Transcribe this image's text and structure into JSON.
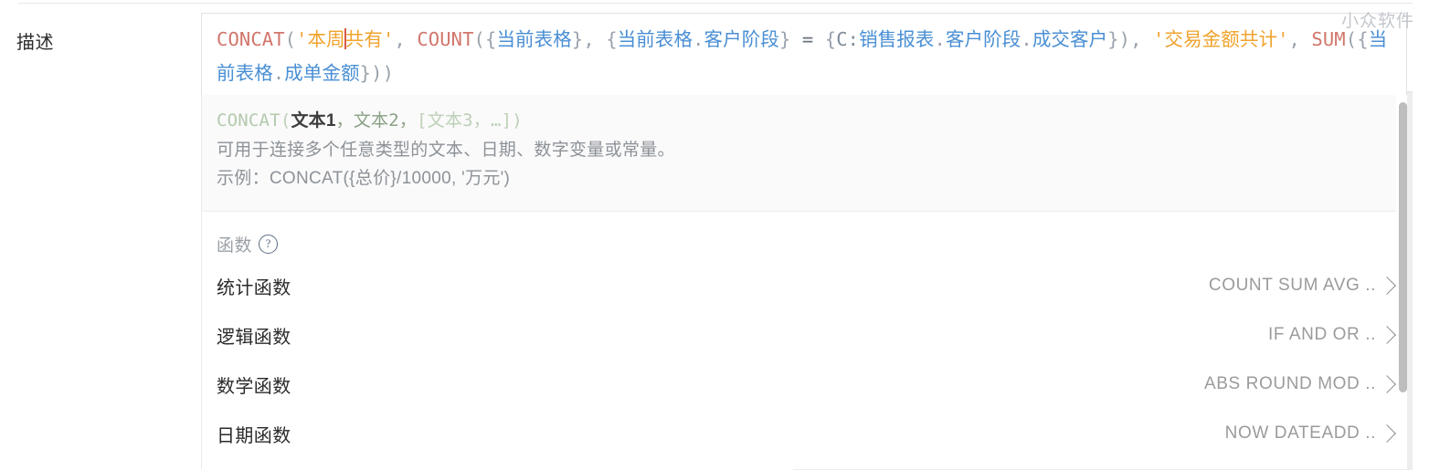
{
  "field": {
    "label": "描述"
  },
  "watermark": {
    "text": "小众软件"
  },
  "formula": {
    "tokens": [
      {
        "t": "fn",
        "v": "CONCAT"
      },
      {
        "t": "punct",
        "v": "("
      },
      {
        "t": "str",
        "v": "'本周"
      },
      {
        "t": "caret",
        "v": ""
      },
      {
        "t": "str",
        "v": "共有'"
      },
      {
        "t": "punct",
        "v": ","
      },
      {
        "t": "space",
        "v": " "
      },
      {
        "t": "fn",
        "v": "COUNT"
      },
      {
        "t": "punct",
        "v": "("
      },
      {
        "t": "brace",
        "v": "{"
      },
      {
        "t": "field",
        "v": "当前表格"
      },
      {
        "t": "brace",
        "v": "}"
      },
      {
        "t": "punct",
        "v": ","
      },
      {
        "t": "space",
        "v": " "
      },
      {
        "t": "brace",
        "v": "{"
      },
      {
        "t": "field",
        "v": "当前表格"
      },
      {
        "t": "dot",
        "v": "."
      },
      {
        "t": "field",
        "v": "客户阶段"
      },
      {
        "t": "brace",
        "v": "}"
      },
      {
        "t": "space",
        "v": " "
      },
      {
        "t": "op",
        "v": "="
      },
      {
        "t": "space",
        "v": " "
      },
      {
        "t": "brace",
        "v": "{"
      },
      {
        "t": "prefix",
        "v": "C:"
      },
      {
        "t": "field",
        "v": "销售报表"
      },
      {
        "t": "dot",
        "v": "."
      },
      {
        "t": "field",
        "v": "客户阶段"
      },
      {
        "t": "dot",
        "v": "."
      },
      {
        "t": "field",
        "v": "成交客户"
      },
      {
        "t": "brace",
        "v": "}"
      },
      {
        "t": "punct",
        "v": ")"
      },
      {
        "t": "punct",
        "v": ","
      },
      {
        "t": "space",
        "v": " "
      },
      {
        "t": "str",
        "v": "'交易金额共计'"
      },
      {
        "t": "punct",
        "v": ","
      },
      {
        "t": "space",
        "v": " "
      },
      {
        "t": "fn",
        "v": "SUM"
      },
      {
        "t": "punct",
        "v": "("
      },
      {
        "t": "brace",
        "v": "{"
      },
      {
        "t": "field",
        "v": "当前表格"
      },
      {
        "t": "dot",
        "v": "."
      },
      {
        "t": "field",
        "v": "成单金额"
      },
      {
        "t": "brace",
        "v": "}"
      },
      {
        "t": "punct",
        "v": ")"
      },
      {
        "t": "punct",
        "v": ")"
      }
    ],
    "plain": "CONCAT('本周共有', COUNT({当前表格}, {当前表格.客户阶段} = {C:销售报表.客户阶段.成交客户}), '交易金额共计', SUM({当前表格.成单金额}))"
  },
  "hint": {
    "signature": {
      "name": "CONCAT",
      "open": "(",
      "required_arg": "文本1",
      "sep1": "，",
      "arg2": "文本2",
      "sep2": "，",
      "optional": "[文本3，…]",
      "close": ")"
    },
    "description": "可用于连接多个任意类型的文本、日期、数字变量或常量。",
    "example": "示例：CONCAT({总价}/10000, '万元')"
  },
  "functions_section": {
    "header_label": "函数",
    "help_icon": "help-circle-icon",
    "rows": [
      {
        "name": "统计函数",
        "preview": "COUNT SUM AVG ..",
        "chevron": "chevron-right-icon"
      },
      {
        "name": "逻辑函数",
        "preview": "IF AND OR ..",
        "chevron": "chevron-right-icon"
      },
      {
        "name": "数学函数",
        "preview": "ABS ROUND MOD ..",
        "chevron": "chevron-right-icon"
      },
      {
        "name": "日期函数",
        "preview": "NOW DATEADD ..",
        "chevron": "chevron-right-icon"
      }
    ]
  },
  "scrollbar": {
    "name": "dropdown-scrollbar"
  },
  "colors": {
    "function_token": "#d2766b",
    "string_token": "#f0a32e",
    "field_token": "#4a8fd4",
    "punct_token": "#9aa3ad",
    "caret": "#d85a43",
    "hint_signature": "#b4c9ae",
    "hint_text": "#8d9298",
    "preview_text": "#9b9b9b",
    "panel_bg": "#fafafa",
    "right_pane_bg": "#ededed"
  }
}
